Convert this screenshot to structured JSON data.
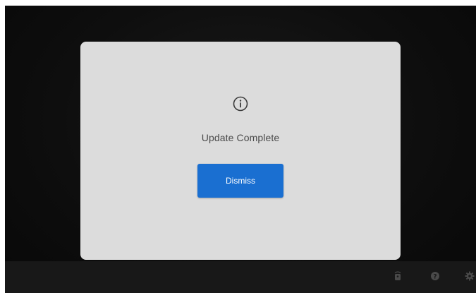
{
  "dialog": {
    "icon": "info-circle-icon",
    "title": "Update Complete",
    "dismiss_label": "Dismiss"
  },
  "taskbar": {
    "icons": [
      "remote-control-icon",
      "help-icon",
      "gear-icon"
    ]
  },
  "colors": {
    "background": "#0e0e0e",
    "dialog": "#dcdcdc",
    "button": "#1a6fd1",
    "taskbar": "#181818"
  }
}
